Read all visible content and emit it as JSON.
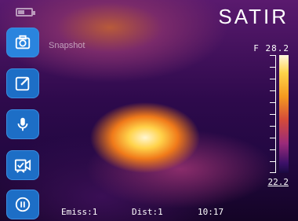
{
  "header": {
    "logo": "SATIR",
    "battery_icon": "battery-icon"
  },
  "toolbar": {
    "snapshot_label": "Snapshot",
    "buttons": [
      {
        "icon": "camera-icon"
      },
      {
        "icon": "edit-icon"
      },
      {
        "icon": "microphone-icon"
      },
      {
        "icon": "video-review-icon"
      },
      {
        "icon": "pause-icon"
      }
    ]
  },
  "scale": {
    "unit": "F",
    "max": "28.2",
    "min": "22.2"
  },
  "status": {
    "emiss": "Emiss:1",
    "dist": "Dist:1",
    "time": "10:17"
  }
}
